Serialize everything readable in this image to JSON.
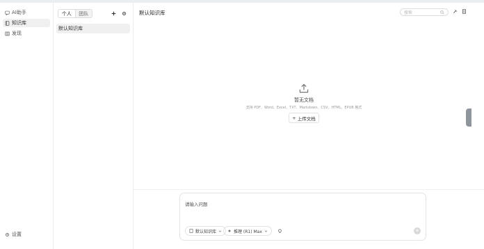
{
  "sidebar": {
    "items": [
      {
        "label": "AI助手",
        "icon": "chat-icon"
      },
      {
        "label": "知识库",
        "icon": "book-icon"
      },
      {
        "label": "发现",
        "icon": "grid-icon"
      }
    ],
    "settings_label": "设置"
  },
  "kb_panel": {
    "tabs": [
      {
        "label": "个人"
      },
      {
        "label": "团队"
      }
    ],
    "items": [
      {
        "label": "默认知识库"
      }
    ]
  },
  "main": {
    "title": "默认知识库",
    "search_placeholder": "搜索",
    "empty_title": "暂无文档",
    "empty_hint": "支持 PDF、Word、Excel、TXT、Markdown、CSV、HTML、EPUB 格式",
    "upload_label": "上传文档"
  },
  "composer": {
    "placeholder": "请输入问题",
    "kb_pill_label": "默认知识库",
    "model_pill_label": "推理 (R1) Max"
  },
  "colors": {
    "accent": "#333333",
    "active_bg": "#f0f0f0"
  }
}
